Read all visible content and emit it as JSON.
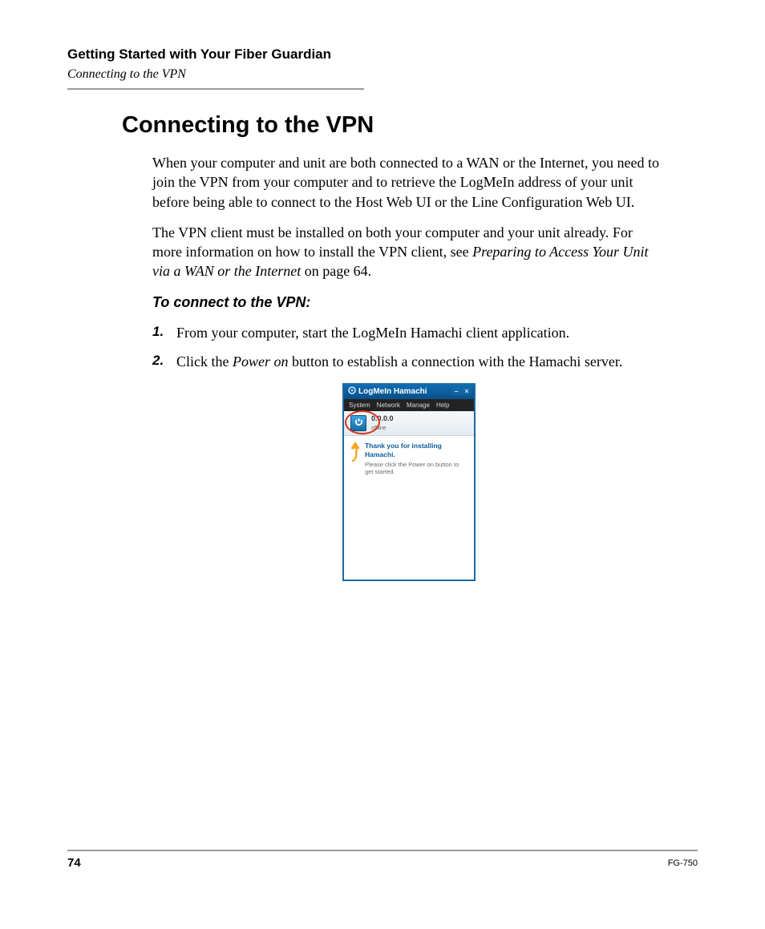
{
  "header": {
    "chapter": "Getting Started with Your Fiber Guardian",
    "section": "Connecting to the VPN"
  },
  "title": "Connecting to the VPN",
  "paragraphs": {
    "p1": "When your computer and unit are both connected to a WAN or the Internet, you need to join the VPN from your computer and to retrieve the LogMeIn address of your unit before being able to connect to the Host Web UI or the Line Configuration Web UI.",
    "p2a": "The VPN client must be installed on both your computer and your unit already. For more information on how to install the VPN client, see ",
    "p2_xref": "Preparing to Access Your Unit via a WAN or the Internet",
    "p2b": " on page 64."
  },
  "procedure": {
    "heading": "To connect to the VPN:",
    "steps": [
      {
        "text": "From your computer, start the LogMeIn Hamachi client application."
      },
      {
        "prefix": "Click the ",
        "em": "Power on",
        "suffix": " button to establish a connection with the Hamachi server."
      }
    ]
  },
  "app": {
    "title": "LogMeIn Hamachi",
    "menus": [
      "System",
      "Network",
      "Manage",
      "Help"
    ],
    "ip": "0.0.0.0",
    "state": "offline",
    "welcome_title": "Thank you for installing Hamachi.",
    "welcome_sub": "Please click the Power on button to get started.",
    "ctrl_min": "–",
    "ctrl_close": "×"
  },
  "footer": {
    "page": "74",
    "doc": "FG-750"
  }
}
